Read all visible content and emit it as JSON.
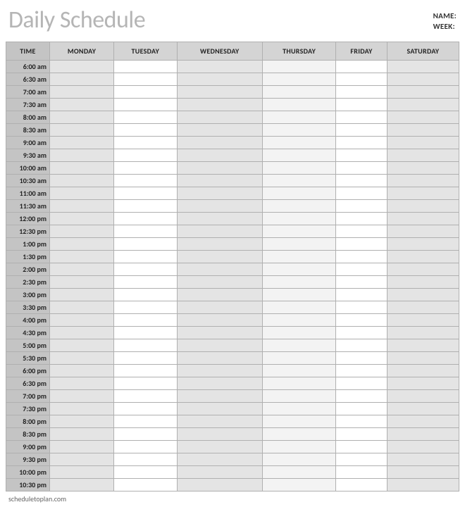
{
  "title": "Daily Schedule",
  "meta": {
    "name_label": "NAME:",
    "week_label": "WEEK:"
  },
  "columns": {
    "time": "TIME",
    "days": [
      "MONDAY",
      "TUESDAY",
      "WEDNESDAY",
      "THURSDAY",
      "FRIDAY",
      "SATURDAY"
    ]
  },
  "times": [
    "6:00 am",
    "6:30 am",
    "7:00 am",
    "7:30 am",
    "8:00 am",
    "8:30 am",
    "9:00 am",
    "9:30 am",
    "10:00 am",
    "10:30 am",
    "11:00 am",
    "11:30 am",
    "12:00 pm",
    "12:30 pm",
    "1:00 pm",
    "1:30 pm",
    "2:00 pm",
    "2:30 pm",
    "3:00 pm",
    "3:30 pm",
    "4:00 pm",
    "4:30 pm",
    "5:00 pm",
    "5:30 pm",
    "6:00 pm",
    "6:30 pm",
    "7:00 pm",
    "7:30 pm",
    "8:00 pm",
    "8:30 pm",
    "9:00 pm",
    "9:30 pm",
    "10:00 pm",
    "10:30 pm"
  ],
  "footer": "scheduletoplan.com"
}
